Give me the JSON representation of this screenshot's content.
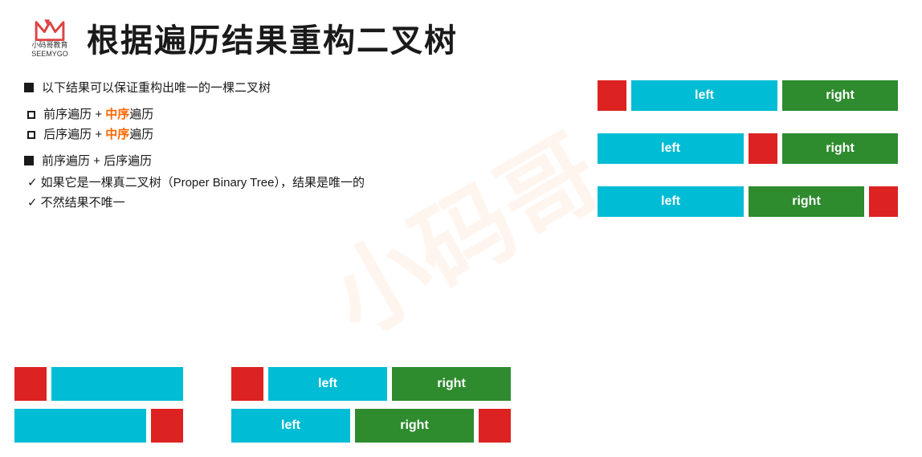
{
  "header": {
    "logo_top_text": "小码哥教育",
    "logo_bottom_text": "SEEMYGO",
    "title": "根据遍历结果重构二叉树"
  },
  "content": {
    "line1": "以下结果可以保证重构出唯一的一棵二叉树",
    "line2_prefix": "前序遍历 + ",
    "line2_highlight": "中序",
    "line2_suffix": "遍历",
    "line3_prefix": "后序遍历 + ",
    "line3_highlight": "中序",
    "line3_suffix": "遍历",
    "line4": "前序遍历 + 后序遍历",
    "line5": "如果它是一棵真二叉树（Proper Binary Tree），结果是唯一的",
    "line6": "不然结果不唯一"
  },
  "diagrams_right": [
    {
      "id": "row1",
      "blocks": [
        {
          "type": "red",
          "w": 36,
          "h": 38
        },
        {
          "type": "cyan",
          "w": 180,
          "h": 38,
          "label": "left"
        },
        {
          "type": "green",
          "w": 140,
          "h": 38,
          "label": "right"
        }
      ]
    },
    {
      "id": "row2",
      "blocks": [
        {
          "type": "cyan",
          "w": 180,
          "h": 38,
          "label": "left"
        },
        {
          "type": "red",
          "w": 36,
          "h": 38
        },
        {
          "type": "green",
          "w": 140,
          "h": 38,
          "label": "right"
        }
      ]
    },
    {
      "id": "row3",
      "blocks": [
        {
          "type": "cyan",
          "w": 180,
          "h": 38,
          "label": "left"
        },
        {
          "type": "green",
          "w": 140,
          "h": 38,
          "label": "right"
        },
        {
          "type": "red",
          "w": 36,
          "h": 38
        }
      ]
    }
  ],
  "diagrams_bottom_left": [
    {
      "id": "bl-row1",
      "blocks": [
        {
          "type": "red",
          "w": 40,
          "h": 42
        },
        {
          "type": "cyan",
          "w": 160,
          "h": 42,
          "label": ""
        }
      ]
    },
    {
      "id": "bl-row2",
      "blocks": [
        {
          "type": "cyan",
          "w": 160,
          "h": 42,
          "label": ""
        },
        {
          "type": "red",
          "w": 40,
          "h": 42
        }
      ]
    }
  ],
  "diagrams_bottom_right": [
    {
      "id": "br-row1",
      "blocks": [
        {
          "type": "red",
          "w": 40,
          "h": 42
        },
        {
          "type": "cyan",
          "w": 150,
          "h": 42,
          "label": "left"
        },
        {
          "type": "green",
          "w": 150,
          "h": 42,
          "label": "right"
        }
      ]
    },
    {
      "id": "br-row2",
      "blocks": [
        {
          "type": "cyan",
          "w": 150,
          "h": 42,
          "label": "left"
        },
        {
          "type": "green",
          "w": 150,
          "h": 42,
          "label": "right"
        },
        {
          "type": "red",
          "w": 40,
          "h": 42
        }
      ]
    }
  ],
  "colors": {
    "red": "#dd2222",
    "cyan": "#00bcd4",
    "green": "#2e8b2e",
    "orange": "#ff6600"
  }
}
